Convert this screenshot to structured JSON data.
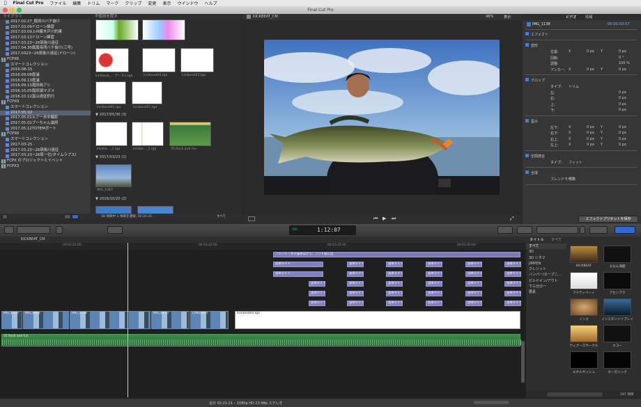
{
  "menu": {
    "apple": "",
    "app": "Final Cut Pro",
    "items": [
      "ファイル",
      "編集",
      "トリム",
      "マーク",
      "クリップ",
      "変更",
      "表示",
      "ウインドウ",
      "ヘルプ"
    ]
  },
  "window_title": "Final Cut Pro",
  "library": {
    "header": "ライブラリ",
    "rows": [
      {
        "text": "2017.02.27_霞田川バチ抜け",
        "kind": "event",
        "indent": 8
      },
      {
        "text": "2017.03.09ドローン練習",
        "kind": "event",
        "indent": 8
      },
      {
        "text": "2017.03.09上州藤木戸川釣果",
        "kind": "event",
        "indent": 8
      },
      {
        "text": "2017.03.13ドローン練習",
        "kind": "event",
        "indent": 8
      },
      {
        "text": "2017.03.23~26筑後川遠征",
        "kind": "event",
        "indent": 8
      },
      {
        "text": "2017.04.30霞南海湾バチ抜け(三号)",
        "kind": "event",
        "indent": 8
      },
      {
        "text": "2017.0323~26筑後川遠征(ドローン)",
        "kind": "event",
        "indent": 8
      },
      {
        "text": "FCPX6",
        "kind": "library",
        "indent": 2
      },
      {
        "text": "スマートコレクション",
        "kind": "folder",
        "indent": 8
      },
      {
        "text": "2016-08-15",
        "kind": "event",
        "indent": 8
      },
      {
        "text": "2016.09.08霞浦",
        "kind": "event",
        "indent": 8
      },
      {
        "text": "2016.09.13霞浦",
        "kind": "event",
        "indent": 8
      },
      {
        "text": "2016.09.13霞田島アシ",
        "kind": "event",
        "indent": 8
      },
      {
        "text": "2016.10.05霞田湖マズメ",
        "kind": "event",
        "indent": 8
      },
      {
        "text": "2016.10.12富山遠征釣行",
        "kind": "event",
        "indent": 8
      },
      {
        "text": "FCPX9",
        "kind": "library",
        "indent": 2
      },
      {
        "text": "スマートコレクション",
        "kind": "folder",
        "indent": 8
      },
      {
        "text": "2017-05-02",
        "kind": "event",
        "indent": 8,
        "selected": true
      },
      {
        "text": "2017.05.01ルアー水中撮影",
        "kind": "event",
        "indent": 8
      },
      {
        "text": "2017.05.02ブーちゃん最終",
        "kind": "event",
        "indent": 8
      },
      {
        "text": "2017.05.12TOTEMポート",
        "kind": "event",
        "indent": 8
      },
      {
        "text": "FCPX8",
        "kind": "library",
        "indent": 2
      },
      {
        "text": "スマートコレクション",
        "kind": "folder",
        "indent": 8
      },
      {
        "text": "2017-03-25",
        "kind": "event",
        "indent": 8
      },
      {
        "text": "2017.03.23~26筑後川遠征",
        "kind": "event",
        "indent": 8
      },
      {
        "text": "2017.03.23~26筑一位(タイムラプス)",
        "kind": "event",
        "indent": 8
      },
      {
        "text": "FCPX のプロジェクトとイベント",
        "kind": "library",
        "indent": 2
      },
      {
        "text": "FCPX3",
        "kind": "library",
        "indent": 2
      }
    ]
  },
  "browser": {
    "filter": "不使用を隠す",
    "clips_r1": [
      "kickbeat_... データ2.tga",
      ""
    ],
    "clips_r2": [
      "kickbeat_... データ2.tga",
      "kickbeat04.tga",
      "kickbeat03.tga"
    ],
    "clips_r3": [
      "kickbeat02.tga",
      "kickbeat01.tga"
    ],
    "date1": "2017/05/30",
    "date1_count": "(3)",
    "clips_r4": [
      "kickbe..._1.tga",
      "kickbe..._1.tga",
      "35 Rock and fun"
    ],
    "date2": "2017/03/23",
    "date2_count": "(1)",
    "clips_r5": [
      "IMG_1087"
    ],
    "date3": "2016/10/20",
    "date3_count": "(2)",
    "footer": "58 項目中 1 項目を選択, 02:21:21",
    "all": "すべて"
  },
  "viewer": {
    "title": "KICKBEAT_CM",
    "zoom": "48%",
    "display": "表示"
  },
  "inspector": {
    "tabs": [
      "ビデオ",
      "情報"
    ],
    "clip": "IMG_1138",
    "timecode": "00:00:03:07",
    "sections": [
      {
        "label": "エフェクト"
      },
      {
        "label": "変形",
        "rows": [
          [
            "位置:",
            "X",
            "0 px",
            "Y",
            "0 px"
          ],
          [
            "回転:",
            "",
            "",
            "",
            "0 °"
          ],
          [
            "調整:",
            "",
            "",
            "",
            "100 %"
          ],
          [
            "アンカー:",
            "X",
            "0 px",
            "Y",
            "0 px"
          ]
        ]
      },
      {
        "label": "クロップ",
        "rows": [
          [
            "タイプ:",
            "トリム",
            "",
            "",
            ""
          ],
          [
            "左:",
            "",
            "",
            "",
            "0 px"
          ],
          [
            "右:",
            "",
            "",
            "",
            "0 px"
          ],
          [
            "上:",
            "",
            "",
            "",
            "0 px"
          ],
          [
            "下:",
            "",
            "",
            "",
            "0 px"
          ]
        ]
      },
      {
        "label": "歪み",
        "rows": [
          [
            "左下:",
            "X",
            "0 px",
            "Y",
            "0 px"
          ],
          [
            "右下:",
            "X",
            "0 px",
            "Y",
            "0 px"
          ],
          [
            "右上:",
            "X",
            "0 px",
            "Y",
            "0 px"
          ],
          [
            "左上:",
            "X",
            "0 px",
            "Y",
            "0 px"
          ]
        ]
      },
      {
        "label": "空間適合",
        "rows": [
          [
            "タイプ:",
            "フィット",
            "",
            "",
            ""
          ]
        ]
      },
      {
        "label": "合成",
        "rows": [
          [
            "ブレンドモード:",
            "標準",
            "",
            "",
            ""
          ]
        ]
      }
    ],
    "save_preset": "エフェクトプリセットを保存"
  },
  "toolbar": {
    "timecode": "1:12:07",
    "fps": "100"
  },
  "timeline": {
    "name": "KICKBEAT_CM",
    "ruler": [
      "00:01:15:00",
      "00:01:20:00",
      "00:01:25:00",
      "00:01:30:00"
    ],
    "top_title": "フェード・文字書体ほかで、フワト様に出",
    "title_label": "基本タイト",
    "video": [
      {
        "label": "IMG_6323",
        "w": 30
      },
      {
        "label": "IMG_6962",
        "w": 66
      },
      {
        "label": "IMG_1138",
        "w": 116
      },
      {
        "label": "IMG_6610",
        "w": 55
      },
      {
        "label": "CIMG4087",
        "w": 55
      }
    ],
    "kick_label": "kickbeat04.tga",
    "music": "35 Rock and fun"
  },
  "titles_browser": {
    "header": "タイトル",
    "all": "すべて",
    "categories": [
      "すべて",
      "3D",
      "3D シネマ",
      "JIMPEN",
      "クレジット",
      "バンパー/オープニ...",
      "ビルドイン/アウト",
      "下三分の一",
      "要素"
    ],
    "items": [
      "KICKBEAT",
      "るなん海胆",
      "アクティベート",
      "アセンブラ",
      "インク",
      "インスタントリプレイ",
      "ウィナーズサークル",
      "エコー",
      "エネルギッシュ",
      "オーガニック"
    ],
    "count": "197 項目"
  },
  "status": "合計 02:21:21 – 1080p HD 23.98p ステレオ"
}
